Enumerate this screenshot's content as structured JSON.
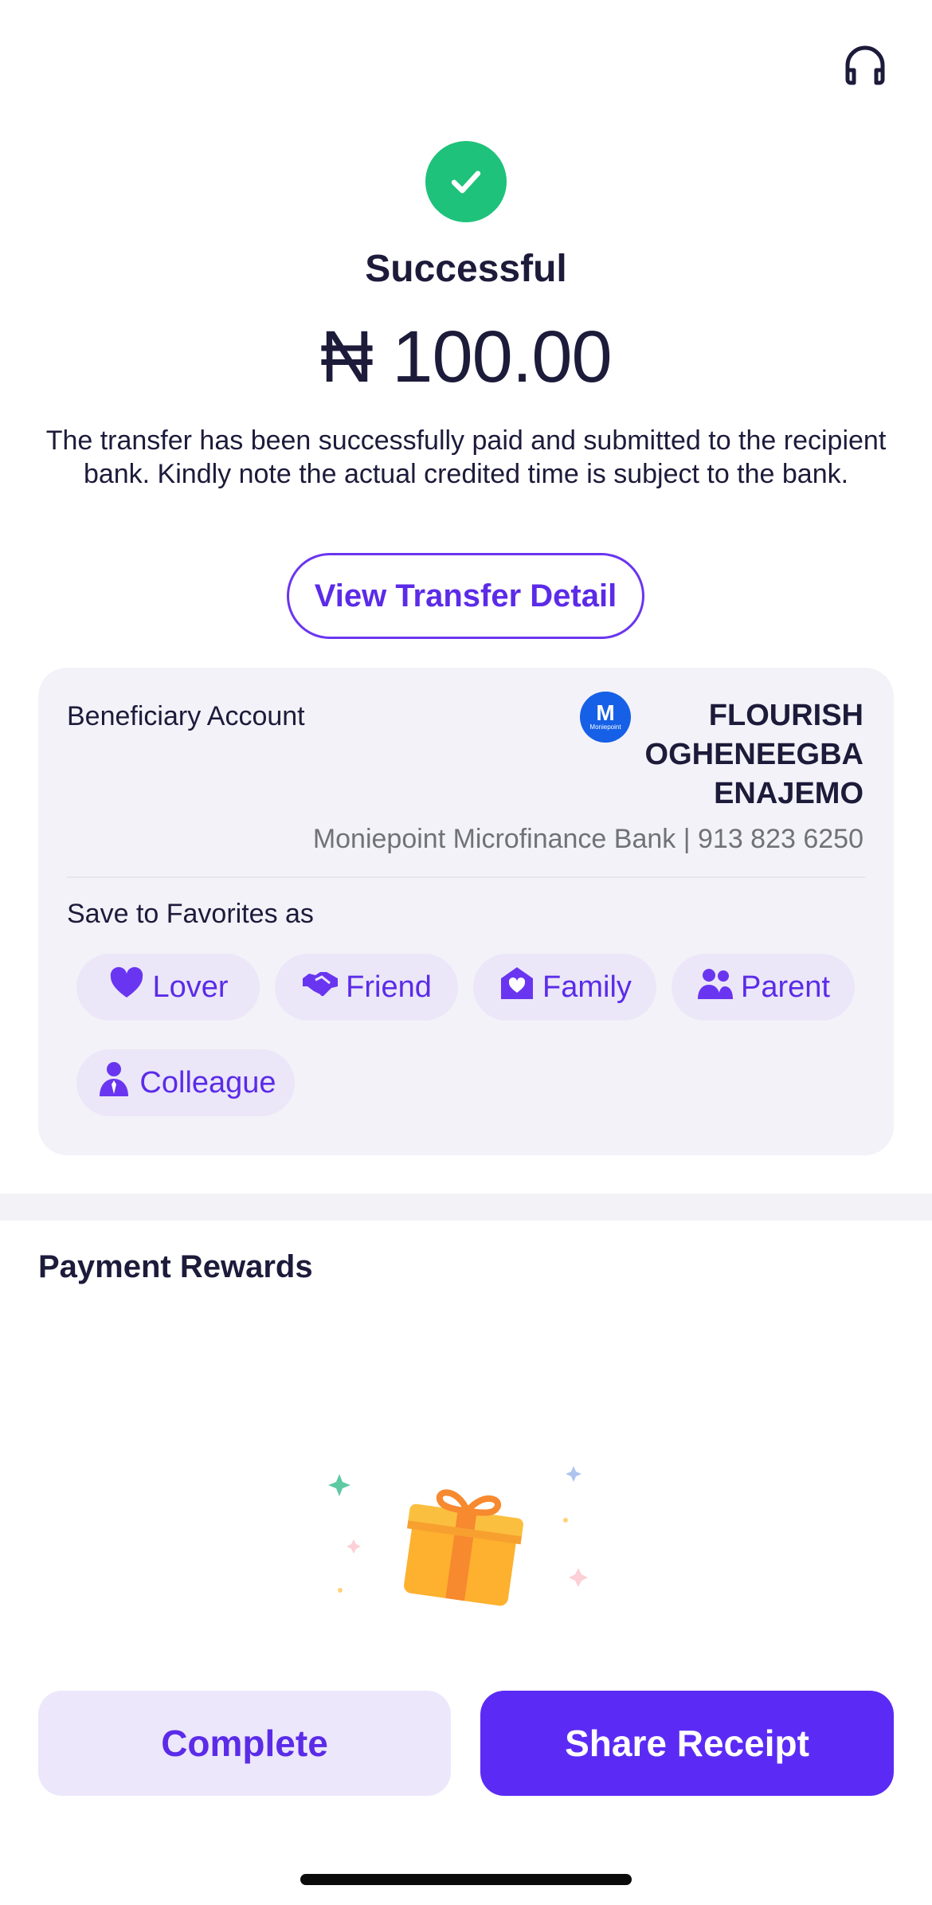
{
  "header": {
    "support_icon": "headset-icon"
  },
  "status": {
    "icon": "check-icon",
    "title": "Successful",
    "amount": "₦ 100.00",
    "message": "The transfer has been successfully paid and submitted to the recipient bank. Kindly note the actual credited time is subject to the bank."
  },
  "view_detail_label": "View Transfer Detail",
  "beneficiary": {
    "label": "Beneficiary Account",
    "logo_letter": "M",
    "logo_text": "Moniepoint",
    "name": "FLOURISH OGHENEEGBA ENAJEMO",
    "bank_line": "Moniepoint Microfinance Bank | 913 823 6250"
  },
  "favorites": {
    "label": "Save to Favorites as",
    "options": [
      {
        "label": "Lover",
        "icon": "heart-icon"
      },
      {
        "label": "Friend",
        "icon": "handshake-icon"
      },
      {
        "label": "Family",
        "icon": "house-heart-icon"
      },
      {
        "label": "Parent",
        "icon": "people-icon"
      },
      {
        "label": "Colleague",
        "icon": "person-tie-icon"
      }
    ]
  },
  "rewards": {
    "title": "Payment Rewards",
    "illustration": "gift-icon"
  },
  "actions": {
    "complete": "Complete",
    "share": "Share Receipt"
  },
  "colors": {
    "accent": "#5b2bf5",
    "success": "#1ec27a",
    "chip_bg": "#ebe7f8",
    "card_bg": "#f3f2f8",
    "bank_logo": "#1560e6"
  }
}
